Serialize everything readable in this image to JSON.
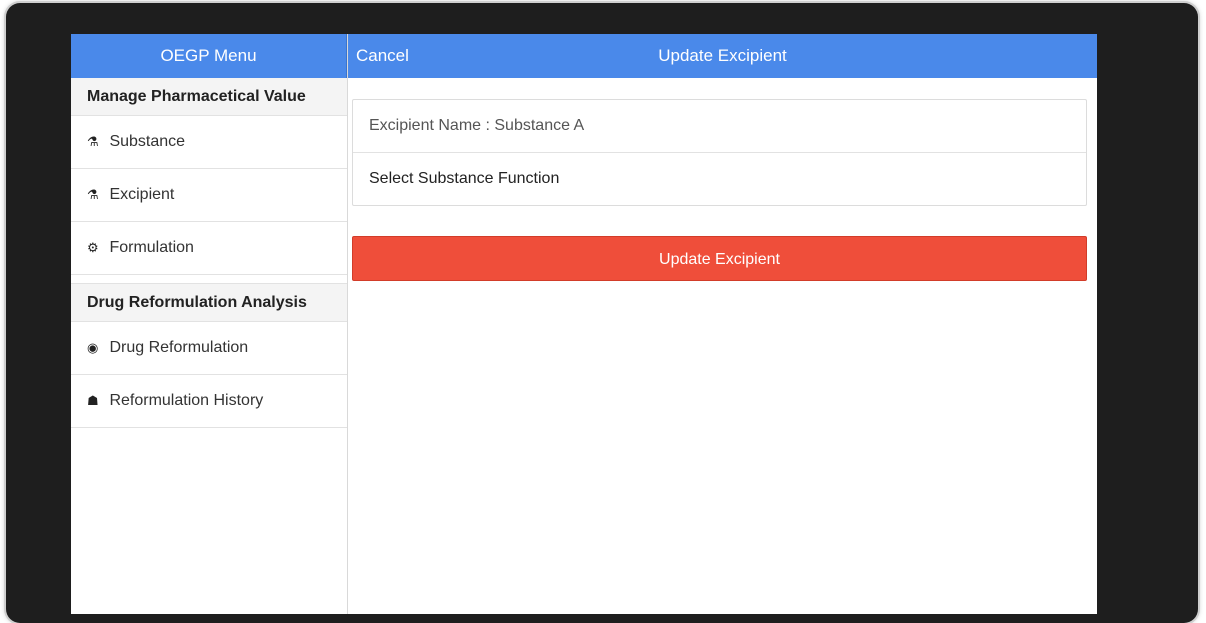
{
  "sidebar": {
    "title": "OEGP Menu",
    "sections": [
      {
        "title": "Manage Pharmacetical Value",
        "items": [
          {
            "icon": "flask-icon",
            "glyph": "⚗",
            "label": "Substance"
          },
          {
            "icon": "excipient-flask-icon",
            "glyph": "⚗",
            "label": "Excipient"
          },
          {
            "icon": "formulation-icon",
            "glyph": "⚙",
            "label": "Formulation"
          }
        ]
      },
      {
        "title": "Drug Reformulation Analysis",
        "items": [
          {
            "icon": "radio-target-icon",
            "glyph": "◉",
            "label": "Drug Reformulation"
          },
          {
            "icon": "history-box-icon",
            "glyph": "☗",
            "label": "Reformulation History"
          }
        ]
      }
    ]
  },
  "topbar": {
    "cancel_label": "Cancel",
    "title": "Update Excipient"
  },
  "form": {
    "excipient_name": "Excipient Name : Substance A",
    "select_function": "Select Substance Function",
    "submit_label": "Update Excipient"
  },
  "colors": {
    "header": "#4a89ea",
    "primary_action": "#ef4e3a"
  }
}
